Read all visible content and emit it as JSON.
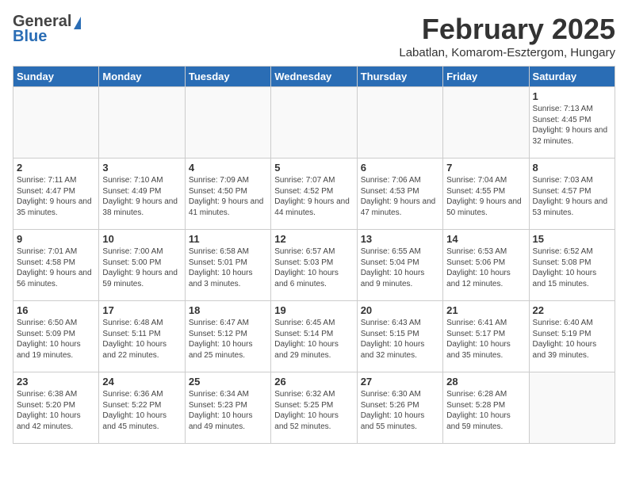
{
  "header": {
    "logo_general": "General",
    "logo_blue": "Blue",
    "month_year": "February 2025",
    "location": "Labatlan, Komarom-Esztergom, Hungary"
  },
  "weekdays": [
    "Sunday",
    "Monday",
    "Tuesday",
    "Wednesday",
    "Thursday",
    "Friday",
    "Saturday"
  ],
  "weeks": [
    [
      {
        "day": "",
        "info": ""
      },
      {
        "day": "",
        "info": ""
      },
      {
        "day": "",
        "info": ""
      },
      {
        "day": "",
        "info": ""
      },
      {
        "day": "",
        "info": ""
      },
      {
        "day": "",
        "info": ""
      },
      {
        "day": "1",
        "info": "Sunrise: 7:13 AM\nSunset: 4:45 PM\nDaylight: 9 hours and 32 minutes."
      }
    ],
    [
      {
        "day": "2",
        "info": "Sunrise: 7:11 AM\nSunset: 4:47 PM\nDaylight: 9 hours and 35 minutes."
      },
      {
        "day": "3",
        "info": "Sunrise: 7:10 AM\nSunset: 4:49 PM\nDaylight: 9 hours and 38 minutes."
      },
      {
        "day": "4",
        "info": "Sunrise: 7:09 AM\nSunset: 4:50 PM\nDaylight: 9 hours and 41 minutes."
      },
      {
        "day": "5",
        "info": "Sunrise: 7:07 AM\nSunset: 4:52 PM\nDaylight: 9 hours and 44 minutes."
      },
      {
        "day": "6",
        "info": "Sunrise: 7:06 AM\nSunset: 4:53 PM\nDaylight: 9 hours and 47 minutes."
      },
      {
        "day": "7",
        "info": "Sunrise: 7:04 AM\nSunset: 4:55 PM\nDaylight: 9 hours and 50 minutes."
      },
      {
        "day": "8",
        "info": "Sunrise: 7:03 AM\nSunset: 4:57 PM\nDaylight: 9 hours and 53 minutes."
      }
    ],
    [
      {
        "day": "9",
        "info": "Sunrise: 7:01 AM\nSunset: 4:58 PM\nDaylight: 9 hours and 56 minutes."
      },
      {
        "day": "10",
        "info": "Sunrise: 7:00 AM\nSunset: 5:00 PM\nDaylight: 9 hours and 59 minutes."
      },
      {
        "day": "11",
        "info": "Sunrise: 6:58 AM\nSunset: 5:01 PM\nDaylight: 10 hours and 3 minutes."
      },
      {
        "day": "12",
        "info": "Sunrise: 6:57 AM\nSunset: 5:03 PM\nDaylight: 10 hours and 6 minutes."
      },
      {
        "day": "13",
        "info": "Sunrise: 6:55 AM\nSunset: 5:04 PM\nDaylight: 10 hours and 9 minutes."
      },
      {
        "day": "14",
        "info": "Sunrise: 6:53 AM\nSunset: 5:06 PM\nDaylight: 10 hours and 12 minutes."
      },
      {
        "day": "15",
        "info": "Sunrise: 6:52 AM\nSunset: 5:08 PM\nDaylight: 10 hours and 15 minutes."
      }
    ],
    [
      {
        "day": "16",
        "info": "Sunrise: 6:50 AM\nSunset: 5:09 PM\nDaylight: 10 hours and 19 minutes."
      },
      {
        "day": "17",
        "info": "Sunrise: 6:48 AM\nSunset: 5:11 PM\nDaylight: 10 hours and 22 minutes."
      },
      {
        "day": "18",
        "info": "Sunrise: 6:47 AM\nSunset: 5:12 PM\nDaylight: 10 hours and 25 minutes."
      },
      {
        "day": "19",
        "info": "Sunrise: 6:45 AM\nSunset: 5:14 PM\nDaylight: 10 hours and 29 minutes."
      },
      {
        "day": "20",
        "info": "Sunrise: 6:43 AM\nSunset: 5:15 PM\nDaylight: 10 hours and 32 minutes."
      },
      {
        "day": "21",
        "info": "Sunrise: 6:41 AM\nSunset: 5:17 PM\nDaylight: 10 hours and 35 minutes."
      },
      {
        "day": "22",
        "info": "Sunrise: 6:40 AM\nSunset: 5:19 PM\nDaylight: 10 hours and 39 minutes."
      }
    ],
    [
      {
        "day": "23",
        "info": "Sunrise: 6:38 AM\nSunset: 5:20 PM\nDaylight: 10 hours and 42 minutes."
      },
      {
        "day": "24",
        "info": "Sunrise: 6:36 AM\nSunset: 5:22 PM\nDaylight: 10 hours and 45 minutes."
      },
      {
        "day": "25",
        "info": "Sunrise: 6:34 AM\nSunset: 5:23 PM\nDaylight: 10 hours and 49 minutes."
      },
      {
        "day": "26",
        "info": "Sunrise: 6:32 AM\nSunset: 5:25 PM\nDaylight: 10 hours and 52 minutes."
      },
      {
        "day": "27",
        "info": "Sunrise: 6:30 AM\nSunset: 5:26 PM\nDaylight: 10 hours and 55 minutes."
      },
      {
        "day": "28",
        "info": "Sunrise: 6:28 AM\nSunset: 5:28 PM\nDaylight: 10 hours and 59 minutes."
      },
      {
        "day": "",
        "info": ""
      }
    ]
  ]
}
